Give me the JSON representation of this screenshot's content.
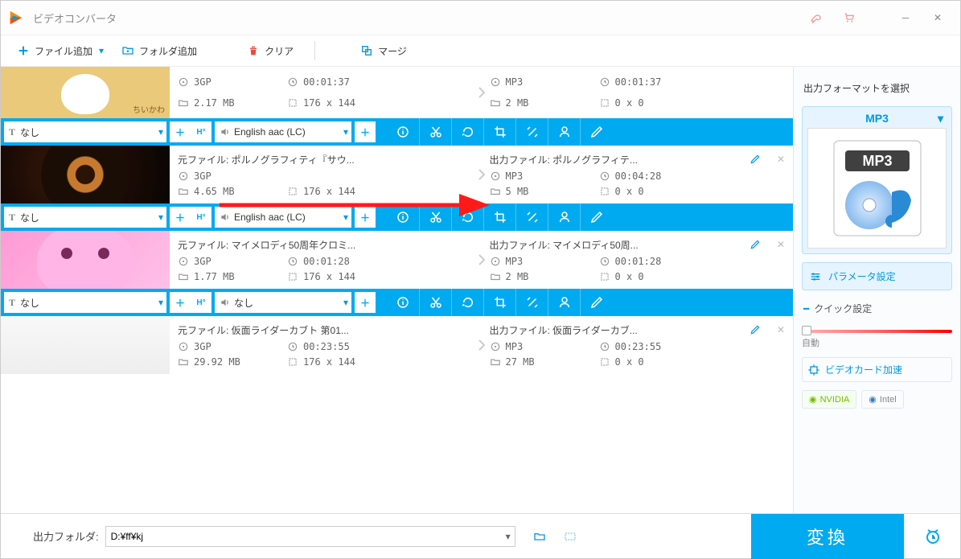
{
  "window": {
    "title": "ビデオコンバータ"
  },
  "toolbar": {
    "add_file": "ファイル追加",
    "add_folder": "フォルダ追加",
    "clear": "クリア",
    "merge": "マージ"
  },
  "sidebar": {
    "format_title": "出力フォーマットを選択",
    "format_selected": "MP3",
    "param_btn": "パラメータ設定",
    "quick_label": "クイック設定",
    "auto": "自動",
    "gpu_label": "ビデオカード加速",
    "brand_nv": "NVIDIA",
    "brand_intel": "Intel"
  },
  "footer": {
    "out_label": "出力フォルダ:",
    "out_path": "D:¥ff¥kj",
    "convert": "変換"
  },
  "subbar": {
    "subtitle_none": "なし",
    "audio_eng": "English aac (LC)",
    "audio_none": "なし"
  },
  "items": [
    {
      "src_fname": "",
      "out_fname": "",
      "src_fmt": "3GP",
      "src_dur": "00:01:37",
      "src_size": "2.17 MB",
      "src_dim": "176 x 144",
      "out_fmt": "MP3",
      "out_dur": "00:01:37",
      "out_size": "2 MB",
      "out_dim": "0 x 0",
      "audio": "English aac (LC)"
    },
    {
      "src_fname": "元ファイル:  ポルノグラフィティ『サウ...",
      "out_fname": "出力ファイル:  ポルノグラフィテ...",
      "src_fmt": "3GP",
      "src_dur": "",
      "src_size": "4.65 MB",
      "src_dim": "176 x 144",
      "out_fmt": "MP3",
      "out_dur": "00:04:28",
      "out_size": "5 MB",
      "out_dim": "0 x 0",
      "audio": "English aac (LC)"
    },
    {
      "src_fname": "元ファイル:  マイメロディ50周年クロミ...",
      "out_fname": "出力ファイル:  マイメロディ50周...",
      "src_fmt": "3GP",
      "src_dur": "00:01:28",
      "src_size": "1.77 MB",
      "src_dim": "176 x 144",
      "out_fmt": "MP3",
      "out_dur": "00:01:28",
      "out_size": "2 MB",
      "out_dim": "0 x 0",
      "audio": "なし"
    },
    {
      "src_fname": "元ファイル:  仮面ライダーカブト  第01...",
      "out_fname": "出力ファイル:  仮面ライダーカブ...",
      "src_fmt": "3GP",
      "src_dur": "00:23:55",
      "src_size": "29.92 MB",
      "src_dim": "176 x 144",
      "out_fmt": "MP3",
      "out_dur": "00:23:55",
      "out_size": "27 MB",
      "out_dim": "0 x 0",
      "audio": ""
    }
  ]
}
